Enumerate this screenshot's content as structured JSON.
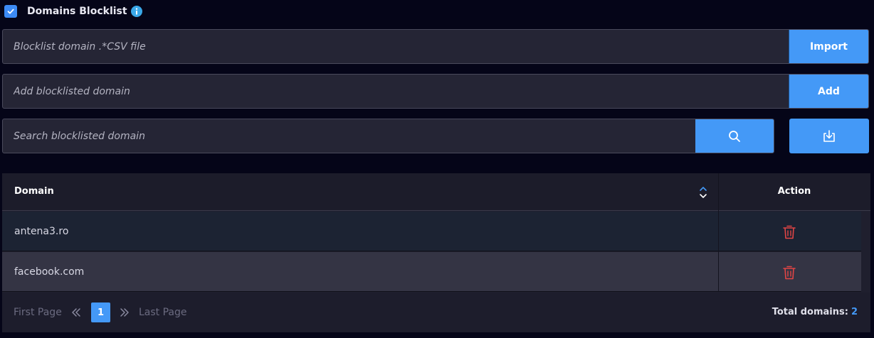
{
  "header": {
    "checked": true,
    "title": "Domains Blocklist",
    "info_icon": "info-icon"
  },
  "import_row": {
    "placeholder": "Blocklist domain .*CSV file",
    "button_label": "Import"
  },
  "add_row": {
    "placeholder": "Add blocklisted domain",
    "button_label": "Add"
  },
  "search_row": {
    "placeholder": "Search blocklisted domain",
    "search_icon": "search-icon",
    "download_icon": "download-icon"
  },
  "table": {
    "columns": [
      "Domain",
      "Action"
    ],
    "rows": [
      {
        "domain": "antena3.ro",
        "action_icon": "trash-icon"
      },
      {
        "domain": "facebook.com",
        "action_icon": "trash-icon"
      }
    ]
  },
  "pagination": {
    "first_label": "First Page",
    "last_label": "Last Page",
    "current_page": "1",
    "total_label": "Total domains:",
    "total_count": "2"
  },
  "colors": {
    "accent": "#4499f7",
    "background": "#050518",
    "danger": "#e24545"
  }
}
